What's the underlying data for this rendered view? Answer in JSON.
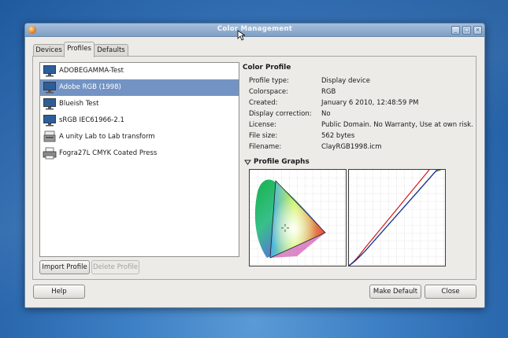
{
  "window": {
    "title": "Color Management"
  },
  "tabs": [
    {
      "label": "Devices"
    },
    {
      "label": "Profiles",
      "active": true
    },
    {
      "label": "Defaults"
    }
  ],
  "profiles_list": {
    "items": [
      {
        "label": "ADOBEGAMMA-Test",
        "icon": "monitor-icon"
      },
      {
        "label": "Adobe RGB (1998)",
        "icon": "monitor-icon",
        "selected": true
      },
      {
        "label": "Blueish Test",
        "icon": "monitor-icon"
      },
      {
        "label": "sRGB IEC61966-2.1",
        "icon": "monitor-icon"
      },
      {
        "label": "A unity Lab to Lab transform",
        "icon": "scanner-icon"
      },
      {
        "label": "Fogra27L CMYK Coated Press",
        "icon": "printer-icon"
      }
    ],
    "import_label": "Import Profile",
    "delete_label": "Delete Profile"
  },
  "color_profile": {
    "heading": "Color Profile",
    "fields": [
      {
        "label": "Profile type:",
        "value": "Display device"
      },
      {
        "label": "Colorspace:",
        "value": "RGB"
      },
      {
        "label": "Created:",
        "value": "January  6 2010, 12:48:59 PM"
      },
      {
        "label": "Display correction:",
        "value": "No"
      },
      {
        "label": "License:",
        "value": "Public Domain. No Warranty, Use at own risk."
      },
      {
        "label": "File size:",
        "value": "562 bytes"
      },
      {
        "label": "Filename:",
        "value": "ClayRGB1998.icm"
      }
    ]
  },
  "profile_graphs": {
    "heading": "Profile Graphs",
    "expander_icon": "triangle-down-icon"
  },
  "buttons": {
    "help": "Help",
    "make_default": "Make Default",
    "close": "Close"
  },
  "colors": {
    "selection": "#7393c4",
    "titlebar": "#8fabd0",
    "desktop": "#3d7fc4"
  }
}
